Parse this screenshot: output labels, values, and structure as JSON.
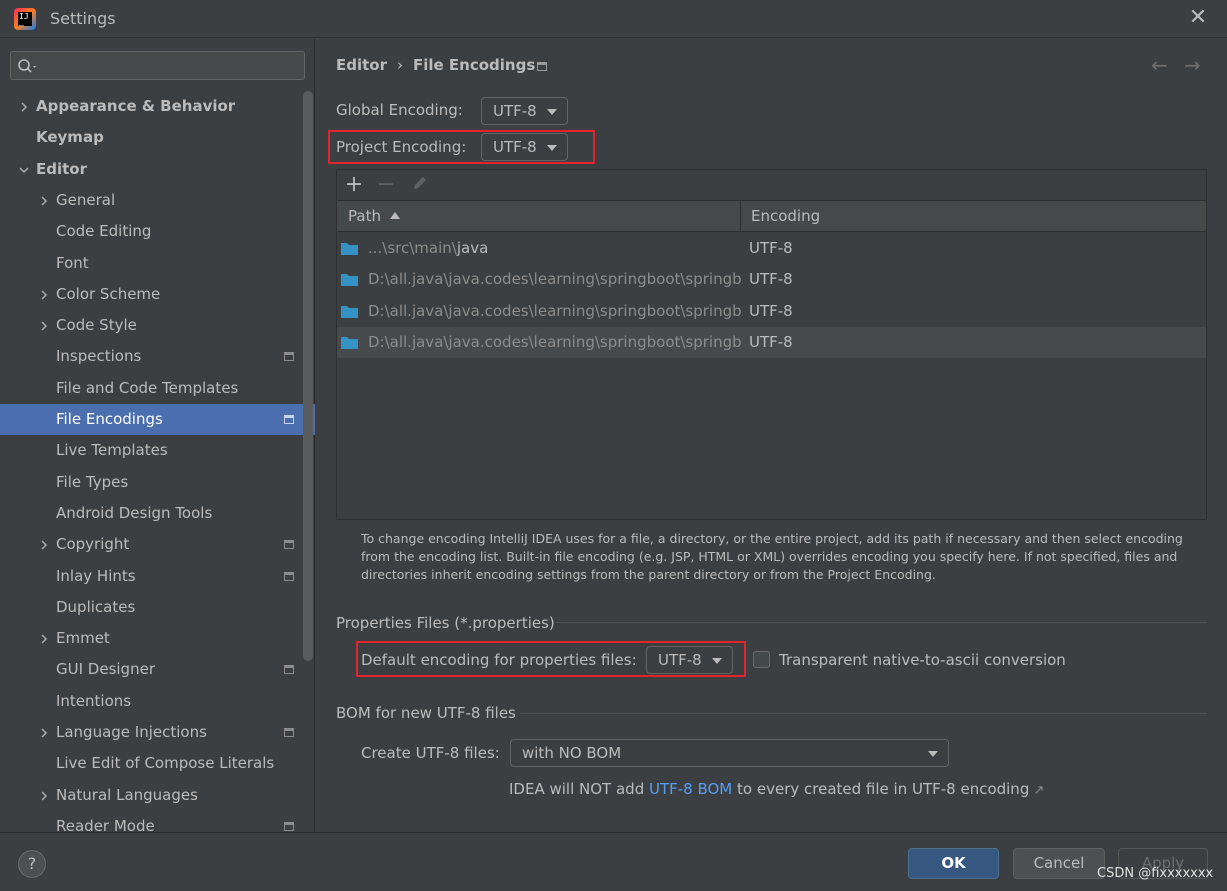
{
  "window": {
    "title": "Settings"
  },
  "sidebar": {
    "items": [
      {
        "label": "Appearance & Behavior",
        "bold": true,
        "level": 0,
        "expandable": true,
        "expanded": false,
        "project": false
      },
      {
        "label": "Keymap",
        "bold": true,
        "level": 0,
        "expandable": false,
        "expanded": false,
        "project": false
      },
      {
        "label": "Editor",
        "bold": true,
        "level": 0,
        "expandable": true,
        "expanded": true,
        "project": false
      },
      {
        "label": "General",
        "bold": false,
        "level": 1,
        "expandable": true,
        "expanded": false,
        "project": false
      },
      {
        "label": "Code Editing",
        "bold": false,
        "level": 1,
        "expandable": false,
        "expanded": false,
        "project": false
      },
      {
        "label": "Font",
        "bold": false,
        "level": 1,
        "expandable": false,
        "expanded": false,
        "project": false
      },
      {
        "label": "Color Scheme",
        "bold": false,
        "level": 1,
        "expandable": true,
        "expanded": false,
        "project": false
      },
      {
        "label": "Code Style",
        "bold": false,
        "level": 1,
        "expandable": true,
        "expanded": false,
        "project": false
      },
      {
        "label": "Inspections",
        "bold": false,
        "level": 1,
        "expandable": false,
        "expanded": false,
        "project": true
      },
      {
        "label": "File and Code Templates",
        "bold": false,
        "level": 1,
        "expandable": false,
        "expanded": false,
        "project": false
      },
      {
        "label": "File Encodings",
        "bold": false,
        "level": 1,
        "expandable": false,
        "expanded": false,
        "project": true,
        "selected": true
      },
      {
        "label": "Live Templates",
        "bold": false,
        "level": 1,
        "expandable": false,
        "expanded": false,
        "project": false
      },
      {
        "label": "File Types",
        "bold": false,
        "level": 1,
        "expandable": false,
        "expanded": false,
        "project": false
      },
      {
        "label": "Android Design Tools",
        "bold": false,
        "level": 1,
        "expandable": false,
        "expanded": false,
        "project": false
      },
      {
        "label": "Copyright",
        "bold": false,
        "level": 1,
        "expandable": true,
        "expanded": false,
        "project": true
      },
      {
        "label": "Inlay Hints",
        "bold": false,
        "level": 1,
        "expandable": false,
        "expanded": false,
        "project": true
      },
      {
        "label": "Duplicates",
        "bold": false,
        "level": 1,
        "expandable": false,
        "expanded": false,
        "project": false
      },
      {
        "label": "Emmet",
        "bold": false,
        "level": 1,
        "expandable": true,
        "expanded": false,
        "project": false
      },
      {
        "label": "GUI Designer",
        "bold": false,
        "level": 1,
        "expandable": false,
        "expanded": false,
        "project": true
      },
      {
        "label": "Intentions",
        "bold": false,
        "level": 1,
        "expandable": false,
        "expanded": false,
        "project": false
      },
      {
        "label": "Language Injections",
        "bold": false,
        "level": 1,
        "expandable": true,
        "expanded": false,
        "project": true
      },
      {
        "label": "Live Edit of Compose Literals",
        "bold": false,
        "level": 1,
        "expandable": false,
        "expanded": false,
        "project": false
      },
      {
        "label": "Natural Languages",
        "bold": false,
        "level": 1,
        "expandable": true,
        "expanded": false,
        "project": false
      },
      {
        "label": "Reader Mode",
        "bold": false,
        "level": 1,
        "expandable": false,
        "expanded": false,
        "project": true
      }
    ]
  },
  "breadcrumb": {
    "parent": "Editor",
    "separator": "›",
    "current": "File Encodings"
  },
  "encodings": {
    "global_label": "Global Encoding:",
    "global_value": "UTF-8",
    "project_label": "Project Encoding:",
    "project_value": "UTF-8"
  },
  "table": {
    "columns": [
      "Path",
      "Encoding"
    ],
    "rows": [
      {
        "dim": "...\\src\\main\\",
        "bright": "java",
        "encoding": "UTF-8"
      },
      {
        "dim": "D:\\all.java\\java.codes\\learning\\springboot\\springboot",
        "bright": "",
        "encoding": "UTF-8"
      },
      {
        "dim": "D:\\all.java\\java.codes\\learning\\springboot\\springboot",
        "bright": "",
        "encoding": "UTF-8"
      },
      {
        "dim": "D:\\all.java\\java.codes\\learning\\springboot\\springboot",
        "bright": "",
        "encoding": "UTF-8"
      }
    ]
  },
  "hint": "To change encoding IntelliJ IDEA uses for a file, a directory, or the entire project, add its path if necessary and then select encoding from the encoding list. Built-in file encoding (e.g. JSP, HTML or XML) overrides encoding you specify here. If not specified, files and directories inherit encoding settings from the parent directory or from the Project Encoding.",
  "properties": {
    "section_title": "Properties Files (*.properties)",
    "default_label": "Default encoding for properties files:",
    "default_value": "UTF-8",
    "transparent_label": "Transparent native-to-ascii conversion"
  },
  "bom": {
    "section_title": "BOM for new UTF-8 files",
    "create_label": "Create UTF-8 files:",
    "create_value": "with NO BOM",
    "note_prefix": "IDEA will NOT add ",
    "note_link": "UTF-8 BOM",
    "note_suffix": " to every created file in UTF-8 encoding"
  },
  "buttons": {
    "help": "?",
    "ok": "OK",
    "cancel": "Cancel",
    "apply": "Apply"
  },
  "watermark": "CSDN @fixxxxxxx",
  "colors": {
    "selection": "#4b6eaf",
    "highlight_box": "#e0262c",
    "link": "#589df6",
    "folder": "#3592c4"
  }
}
